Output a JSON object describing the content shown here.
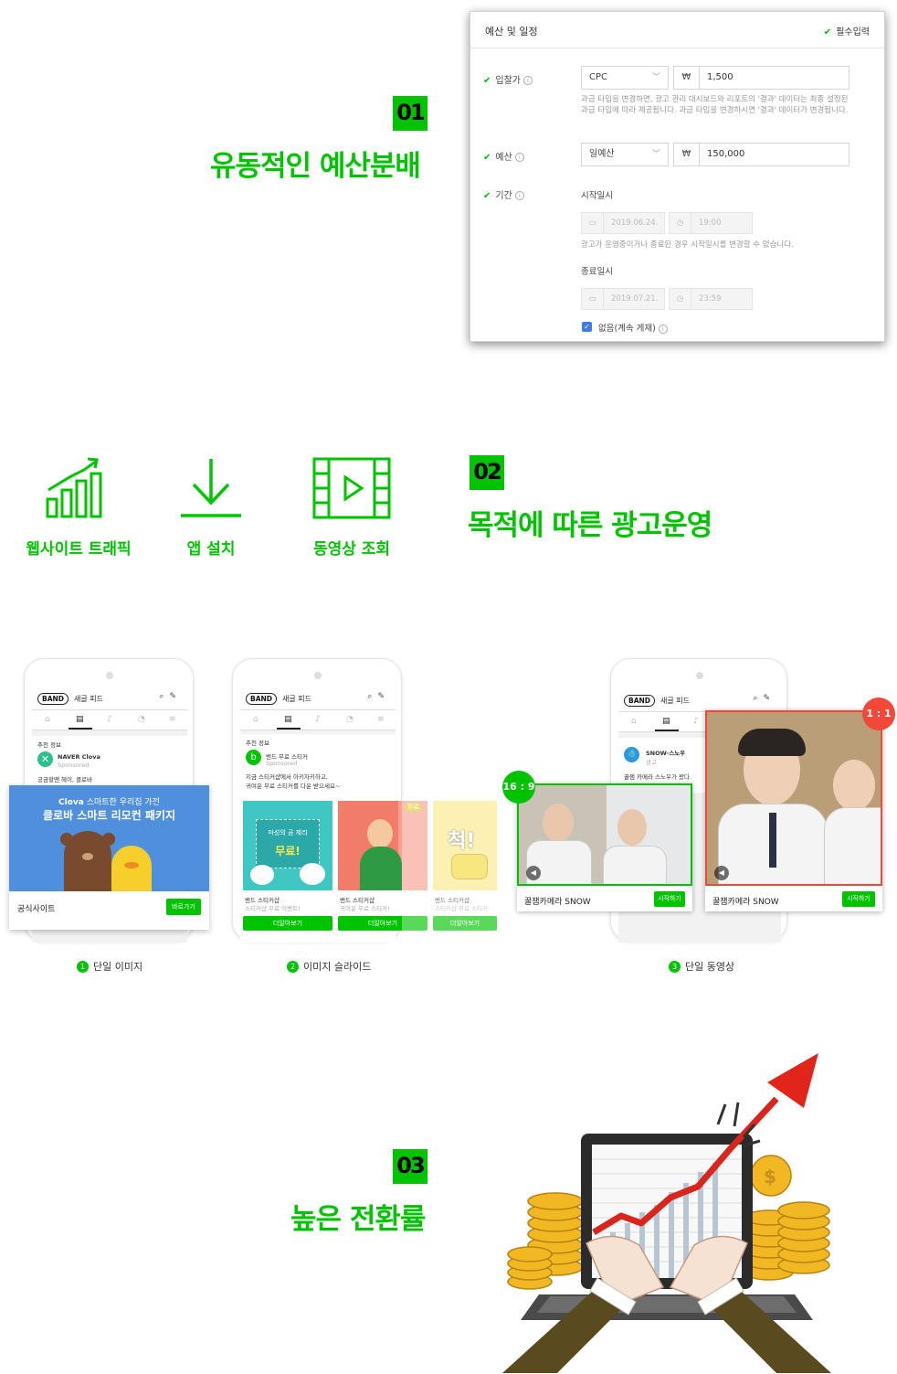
{
  "colors": {
    "brand_green": "#00c300",
    "red_frame": "#f0493a",
    "checkbox_blue": "#3d7ee4"
  },
  "section1": {
    "badge": "01",
    "heading": "유동적인 예산분배",
    "panel": {
      "title": "예산 및 일정",
      "required": "필수입력",
      "bid_label": "입찰가",
      "bid_type": "CPC",
      "currency": "₩",
      "bid_value": "1,500",
      "bid_help": "과금 타입을 변경하면, 광고 관리 대시보드와 리포트의 '결과' 데이터는 최종 설정된 과금 타입에 따라 제공됩니다. 과금 타입을 변경하시면 '결과' 데이터가 변경됩니다.",
      "budget_label": "예산",
      "budget_type": "일예산",
      "budget_value": "150,000",
      "period_label": "기간",
      "start_label": "시작일시",
      "start_date": "2019.06.24.",
      "start_time": "19:00",
      "start_help": "광고가 운영중이거나 종료된 경우 시작일시를 변경할 수 없습니다.",
      "end_label": "종료일시",
      "end_date": "2019.07.21.",
      "end_time": "23:59",
      "no_end_label": "없음(계속 게재)"
    }
  },
  "section2": {
    "badge": "02",
    "heading": "목적에 따른 광고운영",
    "icons": [
      {
        "icon": "traffic-chart-icon",
        "label": "웹사이트 트래픽"
      },
      {
        "icon": "download-icon",
        "label": "앱 설치"
      },
      {
        "icon": "video-film-icon",
        "label": "동영상 조회"
      }
    ]
  },
  "phones": {
    "band_logo": "BAND",
    "band_title": "새글 피드",
    "recommend_label": "추천 정보",
    "phone1": {
      "advertiser": "NAVER Clova",
      "sponsored": "Sponsored",
      "post_text": "궁금할땐 헤이, 클로바",
      "banner_line1_brand": "Clova",
      "banner_line1_rest": "스마트한 우리집 가전",
      "banner_line2": "클로바 스마트 리모컨 패키지",
      "cta_label": "공식사이트",
      "cta_button": "바로가기",
      "caption_num": "1",
      "caption": "단일 이미지"
    },
    "phone2": {
      "advertiser": "밴드 무료 스티커",
      "sponsored": "Sponsored",
      "post_line1": "지금 스티커샵에서 아키자키하고,",
      "post_line2": "귀여운 무료 스티커를 다운 받으세요~",
      "slide1_label": "마성의 곰 제리",
      "slide1_free": "무료!",
      "slide2_tag": "무료",
      "slide3_text": "척!",
      "cards": [
        {
          "title": "밴드 스티커샵",
          "sub": "스티커샵 무료 이벤트!",
          "button": "더알아보기"
        },
        {
          "title": "밴드 스티커샵",
          "sub": "귀여운 무료 스티커!",
          "button": "더알아보기"
        },
        {
          "title": "밴드 스티커샵",
          "sub": "스티커샵 무료 스티커",
          "button": "더알아보기"
        }
      ],
      "caption_num": "2",
      "caption": "이미지 슬라이드"
    },
    "phone3": {
      "advertiser": "SNOW-스노우",
      "ad_label": "광고",
      "post_text": "꿀잼 카메라 스노우가 왔다.",
      "ratio_wide": "16 : 9",
      "ratio_square": "1 : 1",
      "video_title": "꿀잼카메라 SNOW",
      "video_button": "시작하기",
      "caption_num": "3",
      "caption": "단일 동영상"
    }
  },
  "section3": {
    "badge": "03",
    "heading": "높은 전환률"
  }
}
